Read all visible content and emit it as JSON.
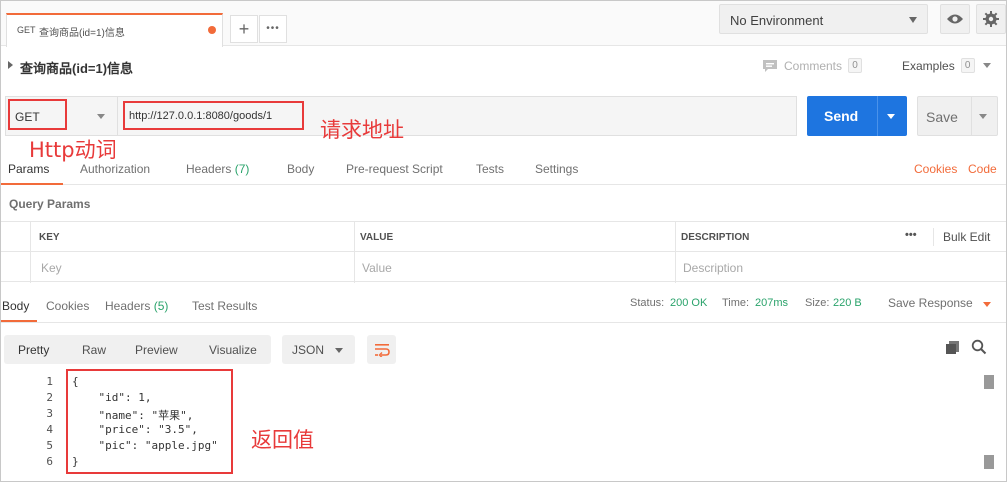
{
  "request_tab": {
    "method": "GET",
    "name": "查询商品(id=1)信息"
  },
  "tab_actions": {
    "add": "+",
    "more": "•••"
  },
  "environment": {
    "selected": "No Environment"
  },
  "request": {
    "title": "查询商品(id=1)信息",
    "comments_label": "Comments",
    "comments_count": "0",
    "examples_label": "Examples",
    "examples_count": "0",
    "method": "GET",
    "url": "http://127.0.0.1:8080/goods/1",
    "send_label": "Send",
    "save_label": "Save"
  },
  "annotations": {
    "url_note": "请求地址",
    "method_note": "Http动词",
    "response_note": "返回值"
  },
  "request_tabs": {
    "params": "Params",
    "authorization": "Authorization",
    "headers": "Headers",
    "headers_count": "(7)",
    "body": "Body",
    "prerequest": "Pre-request Script",
    "tests": "Tests",
    "settings": "Settings",
    "cookies": "Cookies",
    "code": "Code"
  },
  "query_params": {
    "title": "Query Params",
    "columns": [
      "KEY",
      "VALUE",
      "DESCRIPTION"
    ],
    "more": "•••",
    "bulk_edit": "Bulk Edit",
    "placeholders": [
      "Key",
      "Value",
      "Description"
    ]
  },
  "response_tabs": {
    "body": "Body",
    "cookies": "Cookies",
    "headers": "Headers",
    "headers_count": "(5)",
    "test_results": "Test Results"
  },
  "response_status": {
    "status_label": "Status:",
    "status_value": "200 OK",
    "time_label": "Time:",
    "time_value": "207ms",
    "size_label": "Size:",
    "size_value": "220 B",
    "save_response": "Save Response"
  },
  "response_toolbar": {
    "formats": [
      "Pretty",
      "Raw",
      "Preview",
      "Visualize"
    ],
    "selected_format": "Pretty",
    "language": "JSON"
  },
  "response_body": {
    "line_numbers": [
      "1",
      "2",
      "3",
      "4",
      "5",
      "6"
    ],
    "lines": [
      "{",
      "    \"id\": 1,",
      "    \"name\": \"苹果\",",
      "    \"price\": \"3.5\",",
      "    \"pic\": \"apple.jpg\"",
      "}"
    ]
  },
  "colors": {
    "accent": "#f26b3a",
    "send": "#1e75e0",
    "annotation": "#e83a3a",
    "status_ok": "#2aa36b"
  }
}
